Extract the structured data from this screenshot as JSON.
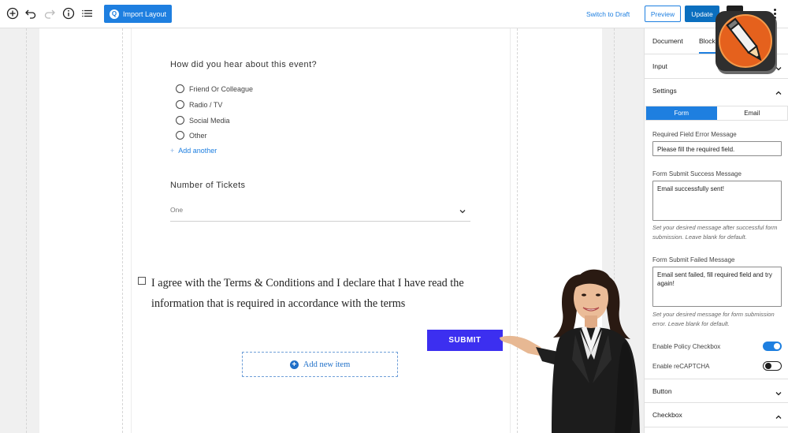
{
  "toolbar": {
    "import_label": "Import Layout",
    "switch_draft": "Switch to Draft",
    "preview": "Preview",
    "update": "Update"
  },
  "form": {
    "question": "How did you hear about this event?",
    "options": [
      "Friend Or Colleague",
      "Radio / TV",
      "Social Media",
      "Other"
    ],
    "add_another": "Add another",
    "tickets_label": "Number of Tickets",
    "tickets_value": "One",
    "agree_text": "I agree with the Terms & Conditions and I declare that I have read the information that is required in accordance with the terms",
    "submit": "SUBMIT",
    "add_item": "Add new item"
  },
  "sidebar": {
    "tabs": [
      "Document",
      "Block"
    ],
    "input_panel": "Input",
    "settings_panel": "Settings",
    "segment": [
      "Form",
      "Email"
    ],
    "required_error_label": "Required Field Error Message",
    "required_error_value": "Please fill the required field.",
    "success_label": "Form Submit Success Message",
    "success_value": "Email successfully sent!",
    "success_help": "Set your desired message after successful form submission. Leave blank for default.",
    "failed_label": "Form Submit Failed Message",
    "failed_value": "Email sent failed, fill required field and try again!",
    "failed_help": "Set your desired message for form submission error. Leave blank for default.",
    "policy_label": "Enable Policy Checkbox",
    "recaptcha_label": "Enable reCAPTCHA",
    "button_panel": "Button",
    "checkbox_panel": "Checkbox"
  },
  "toggles": {
    "policy_enabled": true,
    "recaptcha_enabled": false
  },
  "colors": {
    "accent": "#1e7fe0",
    "submit": "#3c2ff0",
    "update": "#0b6fbf"
  }
}
